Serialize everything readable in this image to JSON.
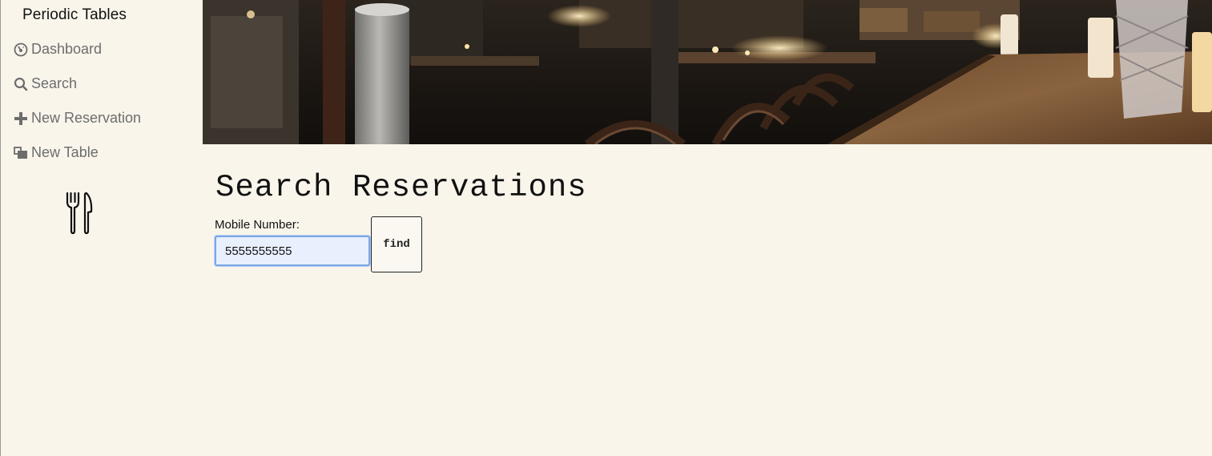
{
  "sidebar": {
    "brand": "Periodic Tables",
    "items": [
      {
        "label": "Dashboard",
        "icon": "dashboard-icon"
      },
      {
        "label": "Search",
        "icon": "search-icon"
      },
      {
        "label": "New Reservation",
        "icon": "plus-icon"
      },
      {
        "label": "New Table",
        "icon": "table-icon"
      }
    ],
    "logo_icon": "fork-knife-icon"
  },
  "hero": {
    "image": "restaurant-bar-photo"
  },
  "main": {
    "title": "Search Reservations",
    "form": {
      "label": "Mobile Number:",
      "value": "5555555555",
      "button_label": "find"
    }
  },
  "colors": {
    "background": "#f9f5eb",
    "nav_text": "#6d6d6d",
    "input_focus": "#7aa6e6",
    "input_bg": "#e8f0fd"
  }
}
